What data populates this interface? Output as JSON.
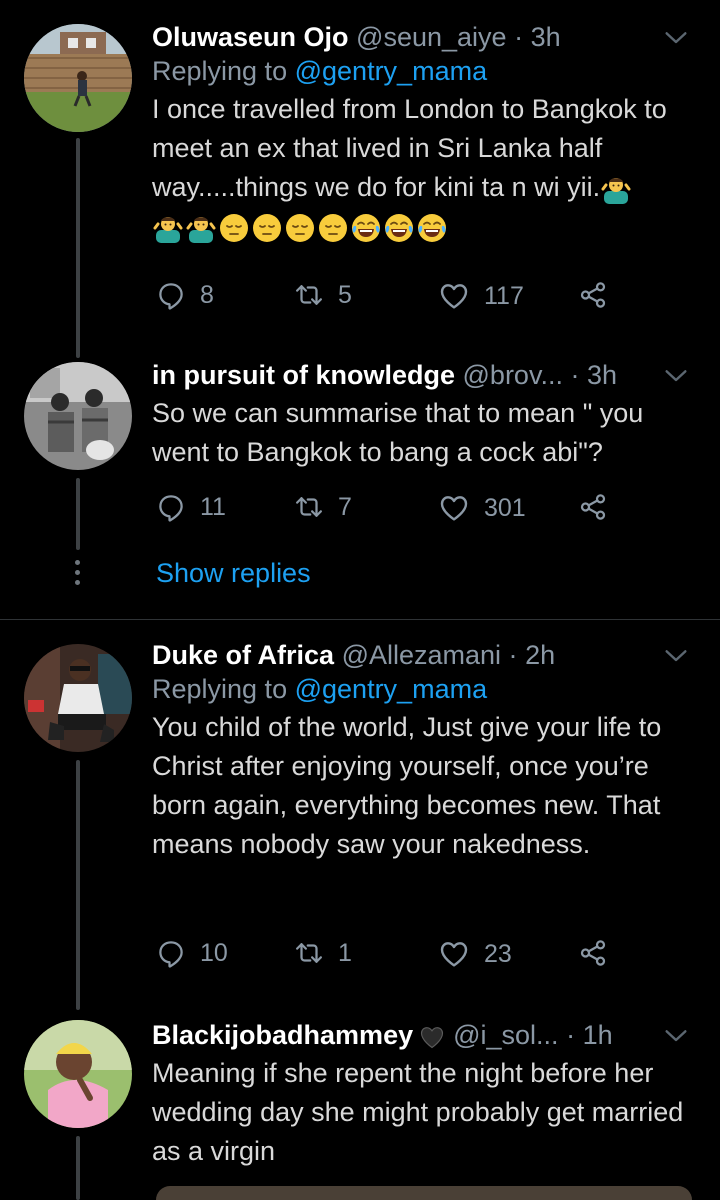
{
  "tweets": [
    {
      "name": "Oluwaseun Ojo",
      "handle": "@seun_aiye",
      "sep": "·",
      "time": "3h",
      "replying_label": "Replying to",
      "replying_to": "@gentry_mama",
      "text": "I once travelled from London to Bangkok to meet an ex that lived in Sri Lanka half way.....things we do for kini ta n wi yii.",
      "emojis": [
        "person-shrugging",
        "person-shrugging",
        "person-shrugging",
        "pensive-face",
        "pensive-face",
        "pensive-face",
        "pensive-face",
        "tears-of-joy",
        "tears-of-joy",
        "tears-of-joy"
      ],
      "replies": "8",
      "retweets": "5",
      "likes": "117"
    },
    {
      "name": "in pursuit of knowledge",
      "handle": "@brov...",
      "sep": "·",
      "time": "3h",
      "text": "So we can summarise that to mean \" you went to Bangkok to bang a cock abi\"?",
      "replies": "11",
      "retweets": "7",
      "likes": "301"
    },
    {
      "name": "Duke of Africa",
      "handle": "@Allezamani",
      "sep": "·",
      "time": "2h",
      "replying_label": "Replying to",
      "replying_to": "@gentry_mama",
      "text": "You child of the world, Just give your life to Christ after enjoying yourself, once you’re born again, everything becomes new. That means nobody saw your nakedness.",
      "replies": "10",
      "retweets": "1",
      "likes": "23"
    },
    {
      "name": "Blackijobadhammey",
      "name_emoji": "black-heart",
      "handle": "@i_sol...",
      "sep": "·",
      "time": "1h",
      "text": "Meaning if she repent the night before her wedding day she might probably get married as a virgin"
    }
  ],
  "show_replies": "Show replies",
  "colors": {
    "background": "#000000",
    "link": "#1da1f2",
    "secondary": "#8b98a5",
    "primary_text": "#d9d9d9",
    "name": "#ffffff"
  }
}
